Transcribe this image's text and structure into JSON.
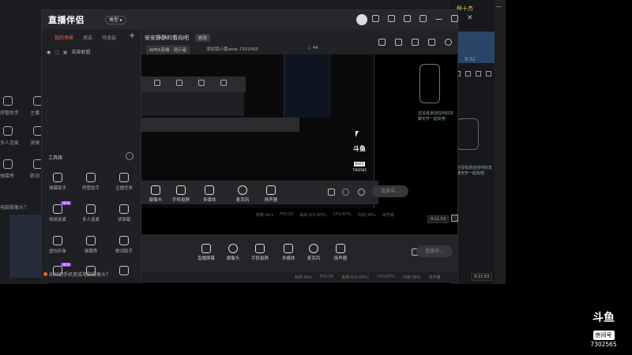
{
  "app": {
    "title": "直播伴侣",
    "mode_badge": "类型 ▸"
  },
  "left_tabs": [
    "我的场景",
    "双击",
    "可收装"
  ],
  "scene_item": "英雄联盟",
  "tools_title": "工具箱",
  "tools": [
    {
      "label": "弹幕助手"
    },
    {
      "label": "房管助手"
    },
    {
      "label": "主播任务"
    },
    {
      "label": "视频连麦",
      "hot": "NEW"
    },
    {
      "label": "多人连麦"
    },
    {
      "label": "读弹幕"
    },
    {
      "label": "虚拟形象"
    },
    {
      "label": "弹幕秀"
    },
    {
      "label": "歌词助手"
    },
    {
      "label": "",
      "hot": "NEW"
    },
    {
      "label": ""
    },
    {
      "label": ""
    }
  ],
  "left_footer": "如何把手机变成电脑摄像头？",
  "bg_left": {
    "labels": [
      "房管助手",
      "主播",
      "多人连麦",
      "读弹",
      "弹幕秀",
      "歌词",
      "电脑摄像头？"
    ]
  },
  "stream": {
    "title": "安安静静的看向吧",
    "edit_label": "修改",
    "category": "APEX英雄 · 语示者",
    "id_text": "添加我小嘉wow  7302565",
    "viewers": "44"
  },
  "bottom_bar": {
    "items": [
      "直播屏幕",
      "摄像头",
      "手机投屏",
      "多媒体",
      "麦克风",
      "扬声器"
    ],
    "connect": "连接中..."
  },
  "inner_bar": {
    "items": [
      "摄像头",
      "手机投屏",
      "多媒体",
      "麦克风",
      "扬声器"
    ],
    "connect": "连接中..."
  },
  "status": {
    "fps_label": "帧数:0k/s",
    "fps": "FPS:30",
    "lost": "丢帧:0(0.00%)",
    "cpu": "CPU:87%",
    "mem": "内存:38%",
    "net": "未开播"
  },
  "inner_status": {
    "fps_label": "帧数:0k/s",
    "fps": "FPS:30",
    "lost": "丢帧:0(0.00%)",
    "cpu": "CPU:87%",
    "mem": "内存:38%",
    "net": "未开播"
  },
  "time": "9:11:52",
  "time_small": "9:11:53",
  "right_panel": {
    "pill": "种十杰",
    "time": "9:32",
    "msg": "还没有添加任何好友\n聊天开一起玩吧"
  },
  "overlay_msg": "还没有添加任何好友\n聊天开一起玩吧",
  "watermark": {
    "logo": "斗鱼",
    "room_label": "房间号",
    "room_id": "7302565"
  }
}
